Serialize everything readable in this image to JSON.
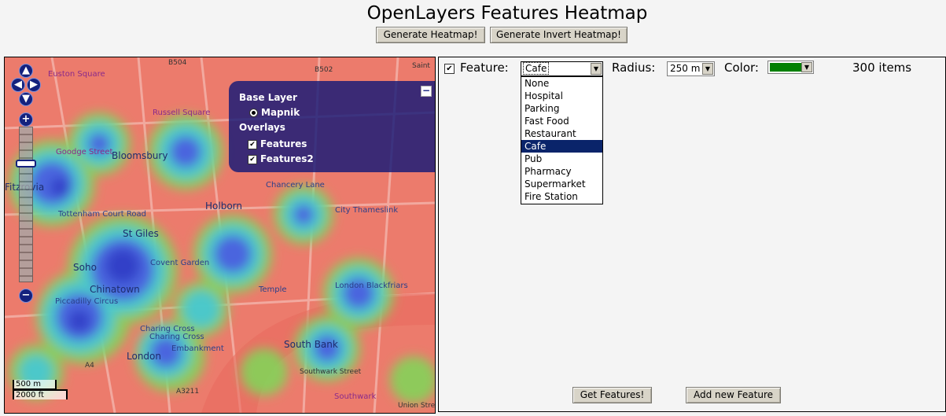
{
  "title": "OpenLayers Features Heatmap",
  "buttons": {
    "generate": "Generate Heatmap!",
    "generate_invert": "Generate Invert Heatmap!",
    "get_features": "Get Features!",
    "add_feature": "Add new Feature"
  },
  "map": {
    "layer_switcher": {
      "base_heading": "Base Layer",
      "base_layer": "Mapnik",
      "overlays_heading": "Overlays",
      "overlays": [
        "Features",
        "Features2"
      ],
      "minimize": "−"
    },
    "zoom_in": "+",
    "zoom_out": "−",
    "zoom_mid": "−",
    "scale": {
      "metric": "500 m",
      "imperial": "2000 ft"
    },
    "labels": {
      "euston_square": "Euston Square",
      "russell_square": "Russell Square",
      "goodge_street": "Goodge Street",
      "bloomsbury": "Bloomsbury",
      "fitzrovia": "Fitzrovia",
      "holborn": "Holborn",
      "chancery_lane": "Chancery Lane",
      "tottenham": "Tottenham Court Road",
      "st_giles": "St Giles",
      "city_thameslink": "City Thameslink",
      "covent_garden": "Covent Garden",
      "soho": "Soho",
      "piccadilly_circus": "Piccadilly Circus",
      "chinatown": "Chinatown",
      "temple": "Temple",
      "london_blackfriars": "London Blackfriars",
      "charing_cross_1": "Charing Cross",
      "charing_cross_2": "Charing Cross",
      "embankment": "Embankment",
      "london": "London",
      "south_bank": "South Bank",
      "southwark": "Southwark",
      "southwark_street": "Southwark Street",
      "union_street": "Union Street",
      "b504": "B504",
      "b502": "B502",
      "a4": "A4",
      "a3211": "A3211",
      "saint": "Saint"
    }
  },
  "panel": {
    "feature_label": "Feature:",
    "feature_value": "Cafe",
    "radius_label": "Radius:",
    "radius_value": "250 m",
    "color_label": "Color:",
    "color_value": "#008000",
    "item_count": "300 items",
    "feature_options": [
      "None",
      "Hospital",
      "Parking",
      "Fast Food",
      "Restaurant",
      "Cafe",
      "Pub",
      "Pharmacy",
      "Supermarket",
      "Fire Station"
    ],
    "selected_option": "Cafe"
  }
}
